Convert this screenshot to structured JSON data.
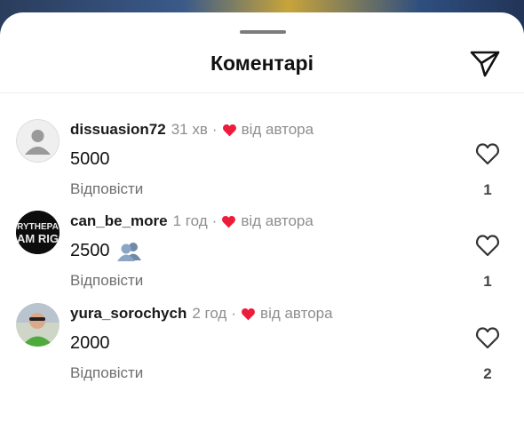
{
  "sheet": {
    "title": "Коментарі"
  },
  "comments": [
    {
      "username": "dissuasion72",
      "time": "31 хв",
      "author_badge": "від автора",
      "text": "5000",
      "emoji": "",
      "reply_label": "Відповісти",
      "likes": "1"
    },
    {
      "username": "can_be_more",
      "time": "1 год",
      "author_badge": "від автора",
      "text": "2500",
      "emoji": "bust-in-silhouette-pair",
      "reply_label": "Відповісти",
      "likes": "1"
    },
    {
      "username": "yura_sorochych",
      "time": "2 год",
      "author_badge": "від автора",
      "text": "2000",
      "emoji": "",
      "reply_label": "Відповісти",
      "likes": "2"
    }
  ],
  "avatar_texts": {
    "can_be_more": [
      "RYTHEPA",
      "AM RIG"
    ]
  },
  "colors": {
    "heart_red": "#ed1c3a",
    "text_gray": "#8e8e8e"
  },
  "icons": {
    "share": "paper-plane-icon",
    "like": "heart-outline-icon",
    "author_like": "heart-filled-icon"
  }
}
